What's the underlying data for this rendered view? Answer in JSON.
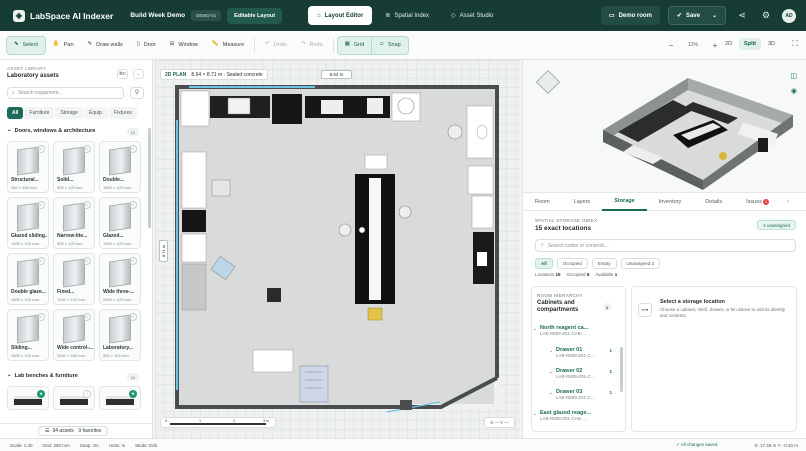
{
  "app": {
    "name": "LabSpace AI Indexer",
    "project": "Build Week Demo",
    "badge": "DEMO-01",
    "editable": "Editable Layout"
  },
  "modes": [
    {
      "label": "Layout Editor"
    },
    {
      "label": "Spatial Index"
    },
    {
      "label": "Asset Studio"
    }
  ],
  "top_right": {
    "demo_room": "Demo room",
    "save": "Save",
    "avatar": "AD"
  },
  "toolbar": {
    "tools": [
      {
        "label": "Select"
      },
      {
        "label": "Pan"
      },
      {
        "label": "Draw walls"
      },
      {
        "label": "Door"
      },
      {
        "label": "Window"
      },
      {
        "label": "Measure"
      }
    ],
    "undo": "Undo",
    "redo": "Redo",
    "grid": "Grid",
    "snap": "Snap",
    "zoom": "11%",
    "views": [
      "2D",
      "Split",
      "3D"
    ]
  },
  "sidebar": {
    "subtitle": "ASSET LIBRARY",
    "title": "Laboratory assets",
    "search_placeholder": "Search equipment...",
    "tabs": [
      "All",
      "Furniture",
      "Storage",
      "Equip.",
      "Fixtures"
    ],
    "section1": "Doors, windows & architecture",
    "section1_count": "12",
    "items": [
      {
        "name": "Structural...",
        "dims": "450 × 450 mm"
      },
      {
        "name": "Solid...",
        "dims": "900 × 120 mm"
      },
      {
        "name": "Double...",
        "dims": "1800 × 120 mm"
      },
      {
        "name": "Glazed sliding...",
        "dims": "1200 × 120 mm"
      },
      {
        "name": "Narrow-lite...",
        "dims": "900 × 120 mm"
      },
      {
        "name": "Glazed...",
        "dims": "1000 × 120 mm"
      },
      {
        "name": "Double glaze...",
        "dims": "1800 × 120 mm"
      },
      {
        "name": "Fixed...",
        "dims": "1200 × 120 mm"
      },
      {
        "name": "Wide three-...",
        "dims": "2400 × 120 mm"
      },
      {
        "name": "Sliding...",
        "dims": "1600 × 120 mm"
      },
      {
        "name": "Wide control-...",
        "dims": "2000 × 160 mm"
      },
      {
        "name": "Laboratory...",
        "dims": "900 × 300 mm"
      }
    ],
    "section2": "Lab benches & furniture",
    "section2_count": "16",
    "footer": "94 assets · 9 favorites"
  },
  "canvas": {
    "plan_label": "2D PLAN",
    "plan_info": "8.64 × 8.71 m · Sealed concrete",
    "dim_top": "8.64 m",
    "dim_left": "8.71 m",
    "scale_labels": [
      "0",
      "1",
      "2",
      "3 m"
    ],
    "coord": "X — Y —"
  },
  "right": {
    "tabs": [
      {
        "label": "Room"
      },
      {
        "label": "Layers"
      },
      {
        "label": "Storage"
      },
      {
        "label": "Inventory"
      },
      {
        "label": "Details"
      },
      {
        "label": "Issues"
      }
    ],
    "issues_count": "1",
    "index_sub": "SPATIAL STORAGE INDEX",
    "index_title": "15 exact locations",
    "unassigned": "2 unassigned",
    "search_placeholder": "Search codes or contents...",
    "chips": [
      "All",
      "Occupied",
      "Empty",
      "Unassigned 2"
    ],
    "stats": {
      "locations_label": "Locations",
      "locations": "15",
      "occupied_label": "Occupied",
      "occupied": "6",
      "available_label": "Available",
      "available": "1"
    },
    "hierarchy_sub": "ROOM HIERARCHY",
    "hierarchy_title": "Cabinets and compartments",
    "hierarchy_count": "6",
    "tree": [
      {
        "label": "North reagent ca...",
        "code": "LAB-R809-Z01-CAB-...",
        "count": ""
      },
      {
        "label": "Drawer 01",
        "code": "LAB-R809-Z01-C...",
        "count": "1"
      },
      {
        "label": "Drawer 02",
        "code": "LAB-R809-Z01-C...",
        "count": "1"
      },
      {
        "label": "Drawer 03",
        "code": "LAB-R809-Z01-C...",
        "count": "1"
      },
      {
        "label": "East glazed reage...",
        "code": "LAB-R809-Z01-CAB-...",
        "count": ""
      }
    ],
    "detail_title": "Select a storage location",
    "detail_desc": "Choose a cabinet, shelf, drawer, or bin above to edit its identity and contents."
  },
  "status": {
    "scale": "Scale: 1:40",
    "grid": "Grid: 250 mm",
    "snap": "Snap: On",
    "units": "Units: m",
    "mode": "Mode: Edit",
    "saved": "All changes saved",
    "xy": "X: 17.48 m  Y: -0.40 m"
  }
}
